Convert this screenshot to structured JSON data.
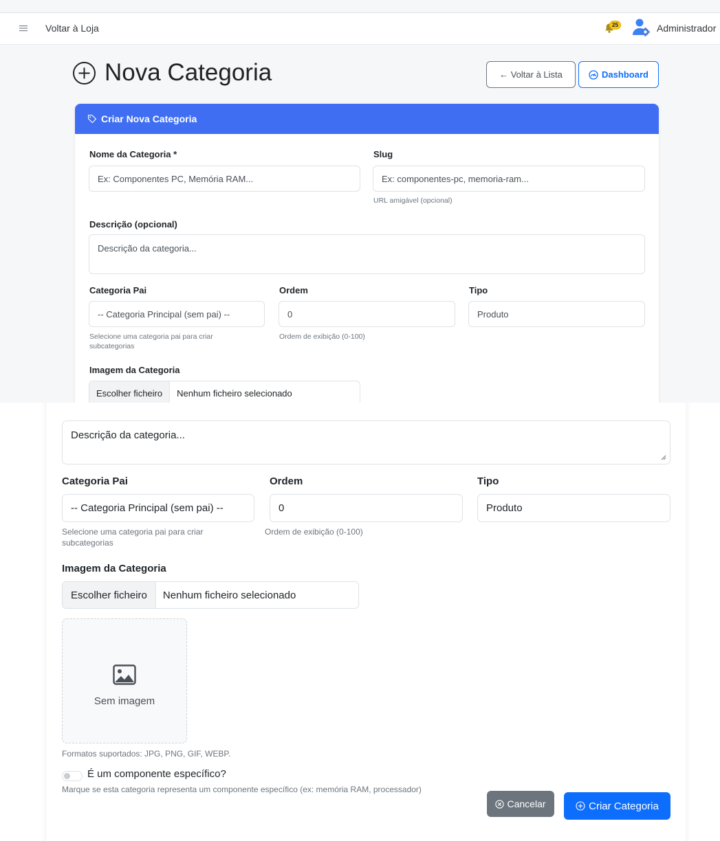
{
  "topbar": {
    "back_to_store": "Voltar à Loja",
    "notification_count": "25",
    "user_name": "Administrador"
  },
  "header": {
    "title": "Nova Categoria",
    "back_button": "← Voltar à Lista",
    "dashboard_button": "Dashboard"
  },
  "card": {
    "title": "Criar Nova Categoria"
  },
  "form": {
    "name_label": "Nome da Categoria *",
    "name_placeholder": "Ex: Componentes PC, Memória RAM...",
    "slug_label": "Slug",
    "slug_placeholder": "Ex: componentes-pc, memoria-ram...",
    "slug_hint": "URL amigável (opcional)",
    "description_label": "Descrição (opcional)",
    "description_placeholder": "Descrição da categoria...",
    "parent_label": "Categoria Pai",
    "parent_value": "-- Categoria Principal (sem pai) --",
    "parent_hint": "Selecione uma categoria pai para criar subcategorias",
    "order_label": "Ordem",
    "order_value": "0",
    "order_hint": "Ordem de exibição (0-100)",
    "type_label": "Tipo",
    "type_value": "Produto",
    "image_label": "Imagem da Categoria",
    "file_button": "Escolher ficheiro",
    "file_status": "Nenhum ficheiro selecionado",
    "no_image": "Sem imagem",
    "formats_hint": "Formatos suportados: JPG, PNG, GIF, WEBP.",
    "component_label": "É um componente específico?",
    "component_checked": false,
    "component_hint": "Marque se esta categoria representa um componente específico (ex: memória RAM, processador)",
    "cancel_button": "Cancelar",
    "submit_button": "Criar Categoria"
  },
  "colors": {
    "primary": "#0d6efd",
    "card_header": "#3f6ef3",
    "secondary": "#6c757d",
    "badge": "#f5c518"
  }
}
